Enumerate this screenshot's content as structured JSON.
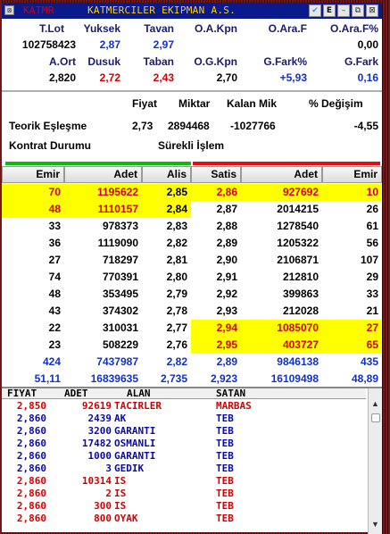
{
  "titlebar": {
    "symbol": "KATMR",
    "company": "KATMERCILER EKIPMAN A.S.",
    "icons": [
      "twitter-icon",
      "e-button",
      "minimize-icon",
      "restore-icon",
      "close-icon"
    ],
    "e_label": "E"
  },
  "summary": {
    "row1_headers": [
      "T.Lot",
      "Yuksek",
      "Tavan",
      "O.A.Kpn",
      "O.Ara.F",
      "O.Ara.F%"
    ],
    "row1_values": [
      "102758423",
      "2,87",
      "2,97",
      "",
      "",
      "0,00"
    ],
    "row2_headers": [
      "A.Ort",
      "Dusuk",
      "Taban",
      "O.G.Kpn",
      "G.Fark%",
      "G.Fark"
    ],
    "row2_values": [
      "2,820",
      "2,72",
      "2,43",
      "2,70",
      "+5,93",
      "0,16"
    ]
  },
  "theoretical": {
    "headers": [
      "Fiyat",
      "Miktar",
      "Kalan Mik",
      "% Değişim"
    ],
    "label": "Teorik Eşleşme",
    "price": "2,73",
    "qty": "2894468",
    "remaining": "-1027766",
    "change": "-4,55",
    "contract_label": "Kontrat Durumu",
    "contract_status": "Sürekli İşlem"
  },
  "depth": {
    "headers": [
      "Emir",
      "Adet",
      "Alis",
      "Satis",
      "Adet",
      "Emir"
    ],
    "rows": [
      {
        "emir_b": "70",
        "adet_b": "1195622",
        "alis": "2,85",
        "satis": "2,86",
        "adet_s": "927692",
        "emir_s": "10"
      },
      {
        "emir_b": "48",
        "adet_b": "1110157",
        "alis": "2,84",
        "satis": "2,87",
        "adet_s": "2014215",
        "emir_s": "26"
      },
      {
        "emir_b": "33",
        "adet_b": "978373",
        "alis": "2,83",
        "satis": "2,88",
        "adet_s": "1278540",
        "emir_s": "61"
      },
      {
        "emir_b": "36",
        "adet_b": "1119090",
        "alis": "2,82",
        "satis": "2,89",
        "adet_s": "1205322",
        "emir_s": "56"
      },
      {
        "emir_b": "27",
        "adet_b": "718297",
        "alis": "2,81",
        "satis": "2,90",
        "adet_s": "2106871",
        "emir_s": "107"
      },
      {
        "emir_b": "74",
        "adet_b": "770391",
        "alis": "2,80",
        "satis": "2,91",
        "adet_s": "212810",
        "emir_s": "29"
      },
      {
        "emir_b": "48",
        "adet_b": "353495",
        "alis": "2,79",
        "satis": "2,92",
        "adet_s": "399863",
        "emir_s": "33"
      },
      {
        "emir_b": "43",
        "adet_b": "374302",
        "alis": "2,78",
        "satis": "2,93",
        "adet_s": "212028",
        "emir_s": "21"
      },
      {
        "emir_b": "22",
        "adet_b": "310031",
        "alis": "2,77",
        "satis": "2,94",
        "adet_s": "1085070",
        "emir_s": "27"
      },
      {
        "emir_b": "23",
        "adet_b": "508229",
        "alis": "2,76",
        "satis": "2,95",
        "adet_s": "403727",
        "emir_s": "65"
      }
    ],
    "totals": [
      {
        "emir_b": "424",
        "adet_b": "7437987",
        "alis": "2,82",
        "satis": "2,89",
        "adet_s": "9846138",
        "emir_s": "435"
      },
      {
        "emir_b": "51,11",
        "adet_b": "16839635",
        "alis": "2,735",
        "satis": "2,923",
        "adet_s": "16109498",
        "emir_s": "48,89"
      }
    ],
    "colors": {
      "highlight": "#ffff00",
      "buy_red": "#d40000",
      "blue": "#1030d0"
    }
  },
  "trades": {
    "headers": [
      "FIYAT",
      "ADET",
      "ALAN",
      "SATAN"
    ],
    "rows": [
      {
        "price": "2,850",
        "qty": "92619",
        "buyer": "TACIRLER",
        "seller": "MARBAS",
        "color": "red"
      },
      {
        "price": "2,860",
        "qty": "2439",
        "buyer": "AK",
        "seller": "TEB",
        "color": "blue"
      },
      {
        "price": "2,860",
        "qty": "3200",
        "buyer": "GARANTI",
        "seller": "TEB",
        "color": "blue"
      },
      {
        "price": "2,860",
        "qty": "17482",
        "buyer": "OSMANLI",
        "seller": "TEB",
        "color": "blue"
      },
      {
        "price": "2,860",
        "qty": "1000",
        "buyer": "GARANTI",
        "seller": "TEB",
        "color": "blue"
      },
      {
        "price": "2,860",
        "qty": "3",
        "buyer": "GEDIK",
        "seller": "TEB",
        "color": "blue"
      },
      {
        "price": "2,860",
        "qty": "10314",
        "buyer": "IS",
        "seller": "TEB",
        "color": "red"
      },
      {
        "price": "2,860",
        "qty": "2",
        "buyer": "IS",
        "seller": "TEB",
        "color": "red"
      },
      {
        "price": "2,860",
        "qty": "300",
        "buyer": "IS",
        "seller": "TEB",
        "color": "red"
      },
      {
        "price": "2,860",
        "qty": "800",
        "buyer": "OYAK",
        "seller": "TEB",
        "color": "red"
      }
    ]
  }
}
